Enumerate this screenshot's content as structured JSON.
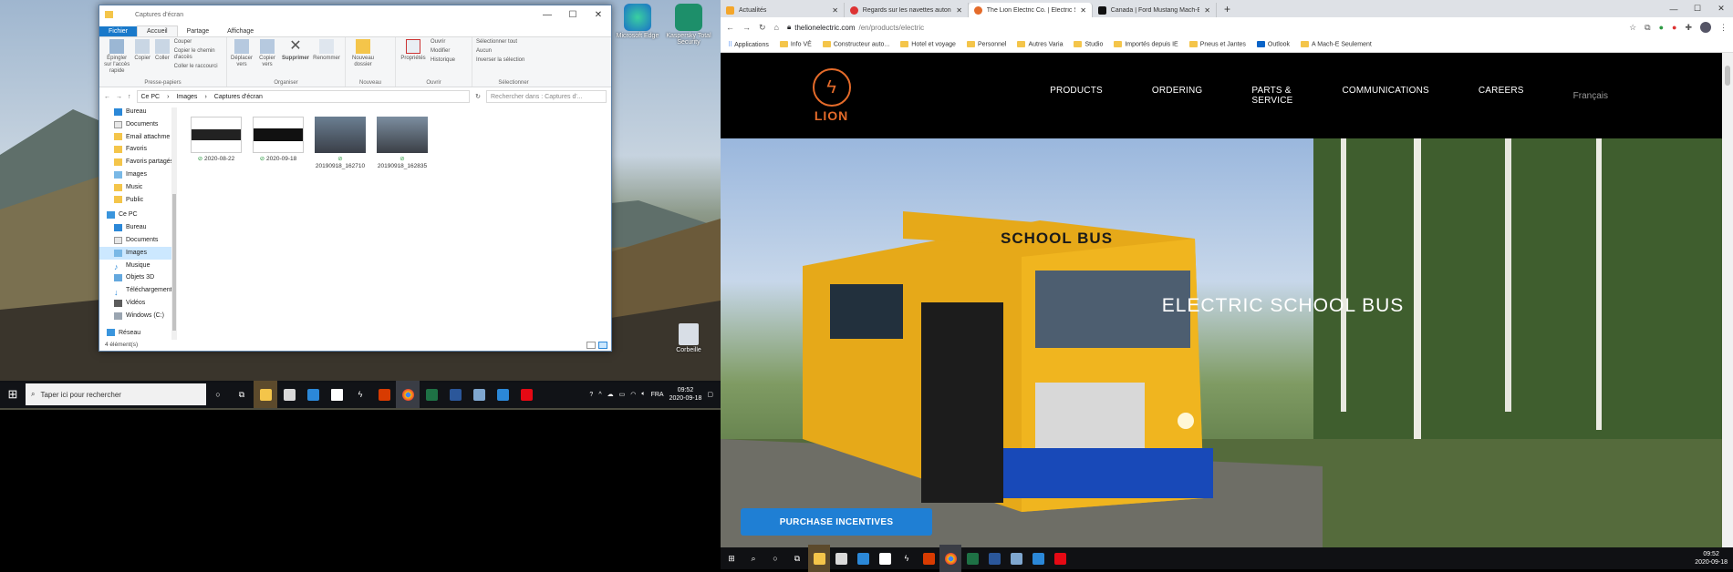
{
  "explorer": {
    "title": "Captures d'écran",
    "window_buttons": [
      "—",
      "☐",
      "✕"
    ],
    "tabs": [
      "Fichier",
      "Accueil",
      "Partage",
      "Affichage"
    ],
    "ribbon": {
      "pin": "Épingler sur l'accès rapide",
      "copy": "Copier",
      "paste": "Coller",
      "cut": "Couper",
      "copy_path": "Copier le chemin d'accès",
      "paste_shortcut": "Coller le raccourci",
      "group_clipboard": "Presse-papiers",
      "move_to": "Déplacer vers",
      "copy_to": "Copier vers",
      "delete": "Supprimer",
      "rename": "Renommer",
      "group_organize": "Organiser",
      "new_folder": "Nouveau dossier",
      "group_new": "Nouveau",
      "properties": "Propriétés",
      "open": "Ouvrir",
      "edit": "Modifier",
      "history": "Historique",
      "group_open": "Ouvrir",
      "select_all": "Sélectionner tout",
      "select_none": "Aucun",
      "invert": "Inverser la sélection",
      "group_select": "Sélectionner"
    },
    "breadcrumb": [
      "Ce PC",
      "Images",
      "Captures d'écran"
    ],
    "search_placeholder": "Rechercher dans : Captures d'...",
    "nav": [
      "Bureau",
      "Documents",
      "Email attachme",
      "Favoris",
      "Favoris partagés",
      "Images",
      "Music",
      "Public",
      "Ce PC",
      "Bureau",
      "Documents",
      "Images",
      "Musique",
      "Objets 3D",
      "Téléchargement",
      "Vidéos",
      "Windows (C:)",
      "Réseau"
    ],
    "files": [
      "2020-08-22",
      "2020-09-18",
      "20190918_162710",
      "20190918_162835"
    ],
    "status": "4 élément(s)"
  },
  "desktop": {
    "icons": [
      "Microsoft Edge",
      "Kaspersky Total Security",
      "Corbeille"
    ]
  },
  "taskbar_left": {
    "search_placeholder": "Taper ici pour rechercher",
    "lang": "FRA",
    "time": "09:52",
    "date": "2020-09-18"
  },
  "browser": {
    "tabs": [
      "Actualités",
      "Regards sur les navettes autonom",
      "The Lion Electric Co. | Electric Sc",
      "Canada | Ford Mustang Mach-E |"
    ],
    "new_tab": "+",
    "url_domain": "thelionelectric.com",
    "url_path": "/en/products/electric",
    "bookmarks": [
      "Applications",
      "Info VÉ",
      "Constructeur auto...",
      "Hotel et voyage",
      "Personnel",
      "Autres Varia",
      "Studio",
      "Importés depuis IE",
      "Pneus et Jantes",
      "Outlook",
      "A Mach-E Seulement"
    ]
  },
  "site": {
    "logo_text": "LION",
    "nav": [
      "PRODUCTS",
      "ORDERING",
      "PARTS & SERVICE",
      "COMMUNICATIONS",
      "CAREERS"
    ],
    "lang": "Français",
    "hero_title": "ELECTRIC SCHOOL BUS",
    "bus_sign": "SCHOOL BUS",
    "cta": "PURCHASE INCENTIVES"
  },
  "taskbar_right": {
    "time": "09:52",
    "date": "2020-09-18"
  }
}
